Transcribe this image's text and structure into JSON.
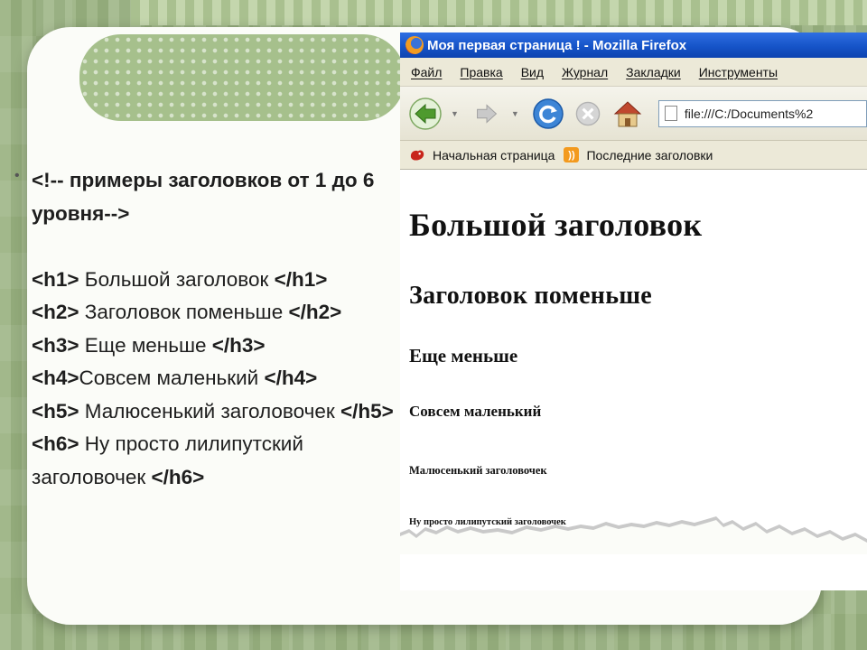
{
  "slide": {
    "bullet_symbol": "•",
    "comment_line": "<!-- примеры заголовков от 1 до 6 уровня-->",
    "code_lines": [
      {
        "open": "<h1>",
        "text": " Большой заголовок ",
        "close": "</h1>"
      },
      {
        "open": "<h2>",
        "text": " Заголовок поменьше ",
        "close": "</h2>"
      },
      {
        "open": "<h3>",
        "text": " Еще меньше ",
        "close": "</h3>"
      },
      {
        "open": "<h4>",
        "text": "Совсем маленький ",
        "close": "</h4>"
      },
      {
        "open": "<h5>",
        "text": " Малюсенький заголовочек ",
        "close": "</h5>"
      },
      {
        "open": "<h6>",
        "text": " Ну просто лилипутский заголовочек ",
        "close": "</h6>"
      }
    ]
  },
  "browser": {
    "window_title": "Моя первая страница ! - Mozilla Firefox",
    "menu": [
      "Файл",
      "Правка",
      "Вид",
      "Журнал",
      "Закладки",
      "Инструменты"
    ],
    "url": "file:///C:/Documents%2",
    "bookmarks": [
      "Начальная страница",
      "Последние заголовки"
    ],
    "headings": {
      "h1": "Большой заголовок",
      "h2": "Заголовок поменьше",
      "h3": "Еще меньше",
      "h4": "Совсем маленький",
      "h5": "Малюсенький заголовочек",
      "h6": "Ну просто лилипутский заголовочек"
    },
    "icons": [
      "firefox-logo-icon",
      "back-arrow-icon",
      "forward-arrow-icon",
      "reload-icon",
      "stop-icon",
      "home-icon",
      "page-icon",
      "bookmark-home-icon",
      "rss-feed-icon"
    ]
  },
  "colors": {
    "background_green": "#97b07e",
    "titlebar_blue": "#1654c8",
    "card_white": "#fbfcf8"
  }
}
